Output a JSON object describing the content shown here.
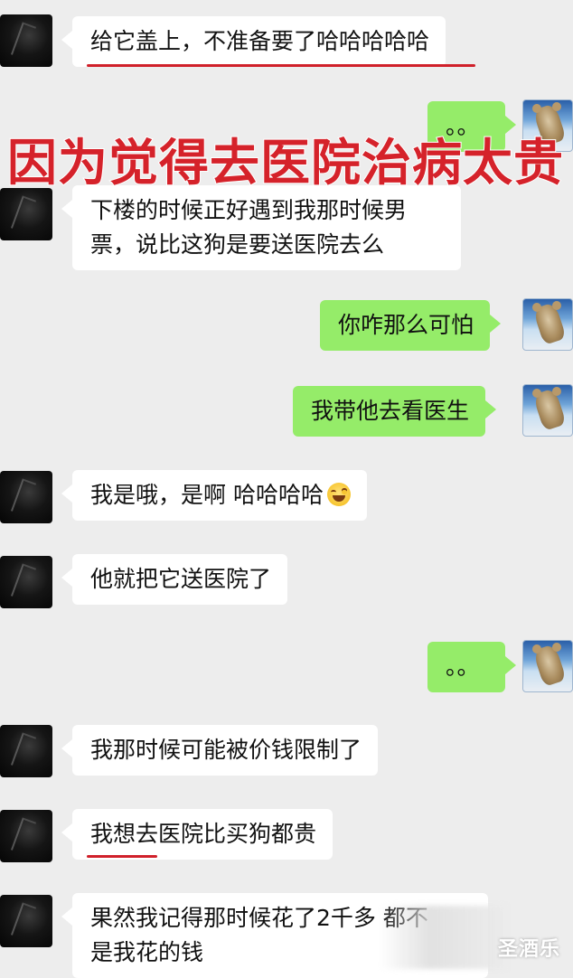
{
  "headline": "因为觉得去医院治病太贵",
  "messages": [
    {
      "id": "m1",
      "side": "in",
      "lines": [
        "给它盖上，不准备要了哈哈哈哈哈"
      ]
    },
    {
      "id": "m2",
      "side": "out",
      "lines": [
        "。。"
      ]
    },
    {
      "id": "m3",
      "side": "in",
      "lines": [
        "下楼的时候正好遇到我那时候男",
        "票，说比这狗是要送医院去么"
      ]
    },
    {
      "id": "m4",
      "side": "out",
      "lines": [
        "你咋那么可怕"
      ]
    },
    {
      "id": "m5",
      "side": "out",
      "lines": [
        "我带他去看医生"
      ]
    },
    {
      "id": "m6",
      "side": "in",
      "lines": [
        "我是哦，是啊 哈哈哈哈"
      ],
      "emoji": "laughing-tears-emoji"
    },
    {
      "id": "m7",
      "side": "in",
      "lines": [
        "他就把它送医院了"
      ]
    },
    {
      "id": "m8",
      "side": "out",
      "lines": [
        "。。"
      ]
    },
    {
      "id": "m9",
      "side": "in",
      "lines": [
        "我那时候可能被价钱限制了"
      ]
    },
    {
      "id": "m10",
      "side": "in",
      "lines": [
        "我想去医院比买狗都贵"
      ]
    },
    {
      "id": "m11",
      "side": "in",
      "lines": [
        "果然我记得那时候花了2千多 都不",
        "是我花的钱"
      ]
    }
  ],
  "watermark": "圣酒乐",
  "colors": {
    "background": "#ededed",
    "incoming_bubble": "#ffffff",
    "outgoing_bubble": "#95ec69",
    "headline": "#d5222a",
    "annotation_underline": "#d0202a"
  }
}
